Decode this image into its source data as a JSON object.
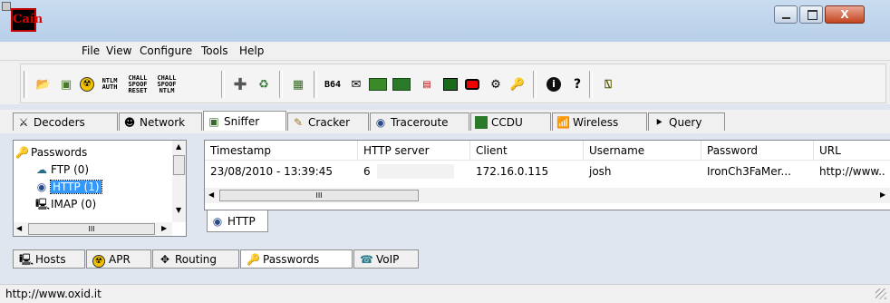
{
  "window": {
    "close_glyph": "X"
  },
  "app": {
    "logo_text": "Caín"
  },
  "menu": {
    "items": [
      "File",
      "View",
      "Configure",
      "Tools",
      "Help"
    ]
  },
  "toolbar": {
    "labels": {
      "ntlm_auth": "NTLM AUTH",
      "chall_spoof_reset": "CHALL SPOOF RESET",
      "chall_spoof_ntlm": "CHALL SPOOF NTLM",
      "b64": "B64"
    }
  },
  "main_tabs": [
    "Decoders",
    "Network",
    "Sniffer",
    "Cracker",
    "Traceroute",
    "CCDU",
    "Wireless",
    "Query"
  ],
  "tree": {
    "root": "Passwords",
    "items": [
      "FTP (0)",
      "HTTP (1)",
      "IMAP (0)"
    ],
    "scroll_dots": "III"
  },
  "table": {
    "columns": [
      "Timestamp",
      "HTTP server",
      "Client",
      "Username",
      "Password",
      "URL"
    ],
    "rows": [
      {
        "timestamp": "23/08/2010 - 13:39:45",
        "http_server": "6",
        "client": "172.16.0.115",
        "username": "josh",
        "password": "IronCh3FaMer...",
        "url": "http://www.."
      }
    ],
    "scroll_dots": "III"
  },
  "sub_tab": {
    "label": "HTTP"
  },
  "bottom_tabs": [
    "Hosts",
    "APR",
    "Routing",
    "Passwords",
    "VoIP"
  ],
  "status": {
    "text": "http://www.oxid.it"
  }
}
